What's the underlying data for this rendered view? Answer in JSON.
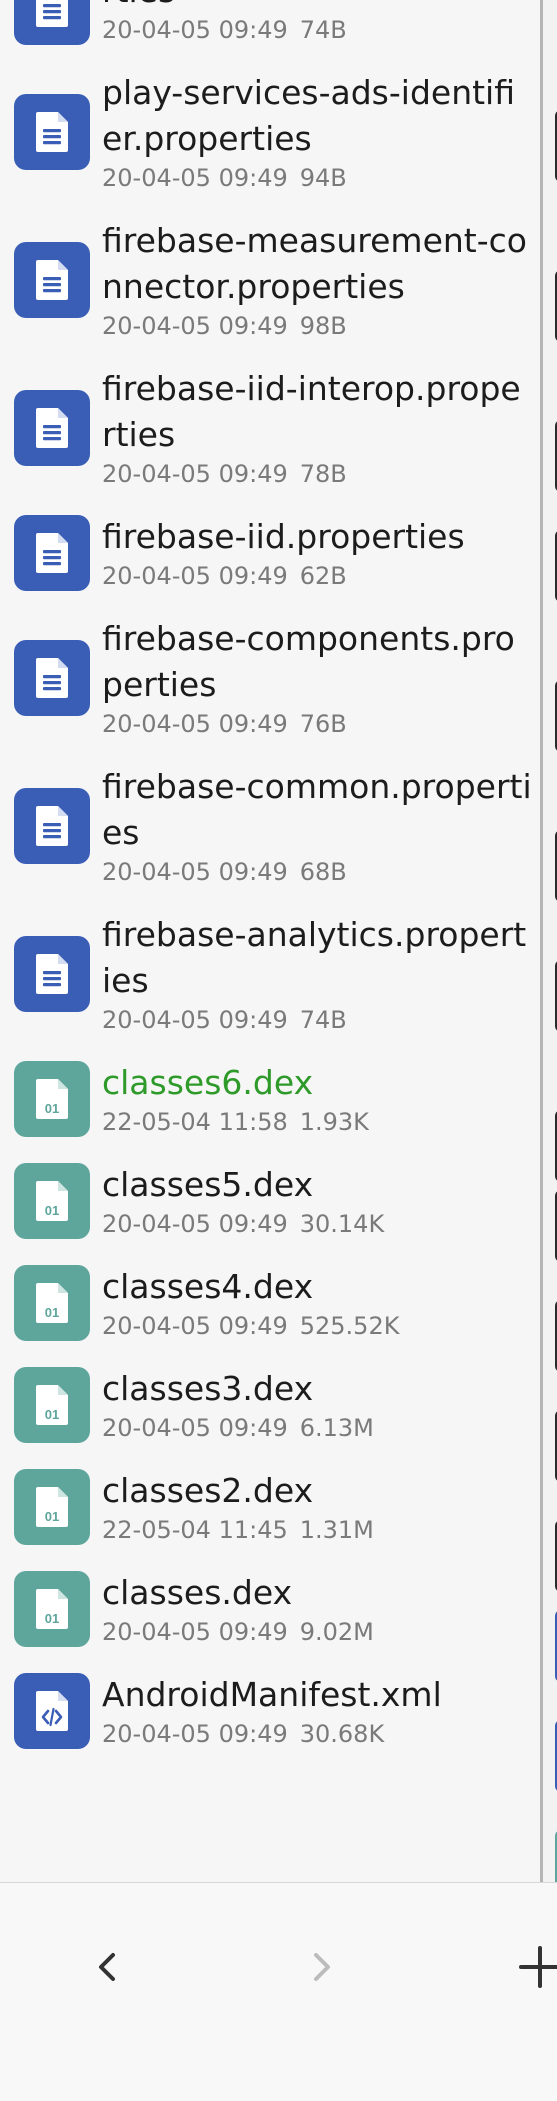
{
  "files": [
    {
      "name": "rties",
      "date": "20-04-05 09:49",
      "size": "74B",
      "icon": "document-icon",
      "type": "doc",
      "highlight": false
    },
    {
      "name": "play-services-ads-identifier.properties",
      "date": "20-04-05 09:49",
      "size": "94B",
      "icon": "document-icon",
      "type": "doc",
      "highlight": false
    },
    {
      "name": "firebase-measurement-connector.properties",
      "date": "20-04-05 09:49",
      "size": "98B",
      "icon": "document-icon",
      "type": "doc",
      "highlight": false
    },
    {
      "name": "firebase-iid-interop.properties",
      "date": "20-04-05 09:49",
      "size": "78B",
      "icon": "document-icon",
      "type": "doc",
      "highlight": false
    },
    {
      "name": "firebase-iid.properties",
      "date": "20-04-05 09:49",
      "size": "62B",
      "icon": "document-icon",
      "type": "doc",
      "highlight": false
    },
    {
      "name": "firebase-components.properties",
      "date": "20-04-05 09:49",
      "size": "76B",
      "icon": "document-icon",
      "type": "doc",
      "highlight": false
    },
    {
      "name": "firebase-common.properties",
      "date": "20-04-05 09:49",
      "size": "68B",
      "icon": "document-icon",
      "type": "doc",
      "highlight": false
    },
    {
      "name": "firebase-analytics.properties",
      "date": "20-04-05 09:49",
      "size": "74B",
      "icon": "document-icon",
      "type": "doc",
      "highlight": false
    },
    {
      "name": "classes6.dex",
      "date": "22-05-04 11:58",
      "size": "1.93K",
      "icon": "binary-file-icon",
      "type": "dex",
      "highlight": true
    },
    {
      "name": "classes5.dex",
      "date": "20-04-05 09:49",
      "size": "30.14K",
      "icon": "binary-file-icon",
      "type": "dex",
      "highlight": false
    },
    {
      "name": "classes4.dex",
      "date": "20-04-05 09:49",
      "size": "525.52K",
      "icon": "binary-file-icon",
      "type": "dex",
      "highlight": false
    },
    {
      "name": "classes3.dex",
      "date": "20-04-05 09:49",
      "size": "6.13M",
      "icon": "binary-file-icon",
      "type": "dex",
      "highlight": false
    },
    {
      "name": "classes2.dex",
      "date": "22-05-04 11:45",
      "size": "1.31M",
      "icon": "binary-file-icon",
      "type": "dex",
      "highlight": false
    },
    {
      "name": "classes.dex",
      "date": "20-04-05 09:49",
      "size": "9.02M",
      "icon": "binary-file-icon",
      "type": "dex",
      "highlight": false
    },
    {
      "name": "AndroidManifest.xml",
      "date": "20-04-05 09:49",
      "size": "30.68K",
      "icon": "code-file-icon",
      "type": "xml",
      "highlight": false
    }
  ],
  "bottom_bar": {
    "back_icon": "chevron-left-icon",
    "forward_icon": "chevron-right-icon",
    "add_icon": "plus-icon"
  },
  "colors": {
    "doc_icon_bg": "#3a5db5",
    "dex_icon_bg": "#5ea59c",
    "highlight_text": "#2e9a2a"
  }
}
